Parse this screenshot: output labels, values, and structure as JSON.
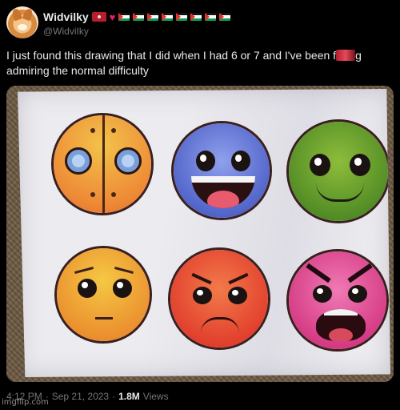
{
  "author": {
    "display_name": "Widvilky",
    "handle": "@WidviIky"
  },
  "tweet": {
    "text_before": "I just found this drawing that I did when I had 6 or 7 and I've been f",
    "text_after": "g admiring the normal difficulty"
  },
  "media": {
    "faces": [
      "easy-face",
      "normal-face",
      "hard-face",
      "harder-face",
      "insane-face",
      "demon-face"
    ]
  },
  "meta": {
    "time": "4:12 PM",
    "separator": "·",
    "date": "Sep 21, 2023",
    "views_count": "1.8M",
    "views_label": "Views"
  },
  "watermark": "imgflip.com",
  "colors": {
    "background": "#000000",
    "text": "#e7e9ea",
    "muted": "#71767b"
  }
}
